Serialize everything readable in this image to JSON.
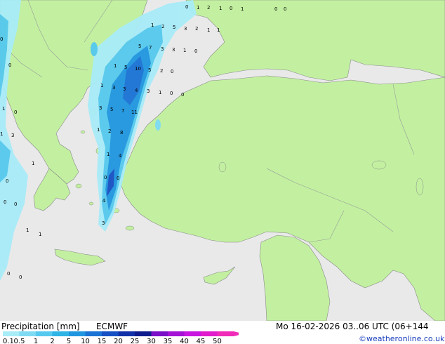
{
  "colors": {
    "sea": "#e9e9e9",
    "land": "#c2f0a0",
    "coast": "#8a8a8a",
    "border": "#9a9a9a",
    "precip_scale": [
      "#a8ecf8",
      "#7fdbf4",
      "#55c9ee",
      "#2fb4e6",
      "#1f96df",
      "#1a73d4",
      "#1650c4",
      "#1231a8",
      "#0e1b8c",
      "#7a0ec8",
      "#a412d6",
      "#c816e0",
      "#e01ccc",
      "#f02bb8"
    ]
  },
  "legend": {
    "title": "Precipitation [mm]",
    "model": "ECMWF",
    "ticks": [
      "0.1",
      "0.5",
      "1",
      "2",
      "5",
      "10",
      "15",
      "20",
      "25",
      "30",
      "35",
      "40",
      "45",
      "50"
    ]
  },
  "run": {
    "valid": "Mo 16-02-2026 03..06 UTC (06+144"
  },
  "credit": "©weatheronline.co.uk",
  "map_labels": [
    "0",
    "1",
    "2",
    "1",
    "0",
    "1",
    "0",
    "0",
    "1",
    "2",
    "5",
    "3",
    "2",
    "1",
    "1",
    "5",
    "7",
    "3",
    "3",
    "1",
    "0",
    "1",
    "5",
    "10",
    "5",
    "2",
    "0",
    "1",
    "3",
    "3",
    "4",
    "3",
    "1",
    "0",
    "0",
    "3",
    "5",
    "7",
    "11",
    "1",
    "2",
    "8",
    "1",
    "4",
    "0",
    "0",
    "4",
    "3",
    "0",
    "0",
    "1",
    "0",
    "1",
    "1",
    "3",
    "1",
    "0",
    "0",
    "0",
    "1",
    "0",
    "0"
  ]
}
